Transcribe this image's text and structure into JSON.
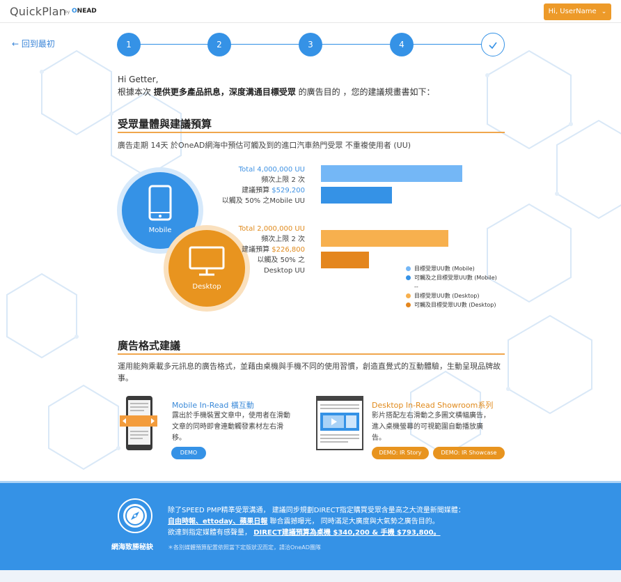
{
  "app": {
    "brand": "QuickPlan",
    "brand_by": "by",
    "brand_company_o": "O",
    "brand_company_rest": "NEAD",
    "user_button": "Hi, UserName"
  },
  "nav": {
    "back_label": "回到最初",
    "steps": [
      "1",
      "2",
      "3",
      "4"
    ]
  },
  "greeting": {
    "hello": "Hi Getter,",
    "line_prefix": "根據本次 ",
    "line_bold": "提供更多產品訊息，深度溝通目標受眾",
    "line_suffix": " 的廣告目的 ，您的建議規畫書如下："
  },
  "audience": {
    "title": "受眾量體與建議預算",
    "description": "廣告走期 14天 於OneAD網海中預估可觸及到的進口汽車熱門受眾 不重複使用者 (UU)",
    "mobile": {
      "label": "Mobile",
      "total": "Total 4,000,000 UU",
      "freq": "頻次上限 2 次",
      "budget_prefix": "建議預算 ",
      "budget": "$529,200",
      "reach": "以觸及 50% 之Mobile UU"
    },
    "desktop": {
      "label": "Desktop",
      "total": "Total 2,000,000 UU",
      "freq": "頻次上限 2 次",
      "budget_prefix": "建議預算 ",
      "budget": "$226,800",
      "reach_line1": "以觸及 50% 之",
      "reach_line2": "Desktop UU"
    },
    "bars": {
      "mobile_target": 1.0,
      "mobile_reach": 0.5,
      "desktop_target": 0.9,
      "desktop_reach": 0.34
    },
    "legend": [
      {
        "label": "目標受眾UU數 (Mobile)",
        "color": "#74b7f6"
      },
      {
        "label": "可觸及之目標受眾UU數 (Mobile)",
        "color": "#3592e6"
      },
      {
        "label": "--",
        "color": ""
      },
      {
        "label": "目標受眾UU數 (Desktop)",
        "color": "#f7b04e"
      },
      {
        "label": "可觸及目標受眾UU數 (Desktop)",
        "color": "#e4861e"
      }
    ]
  },
  "formats": {
    "title": "廣告格式建議",
    "description_line1": "運用能夠乘載多元訊息的廣告格式，並藉由桌機與手機不同的使用習慣，創造直覺式的互動體驗，生動呈現品牌故",
    "description_line2": "事。",
    "mobile": {
      "title": "Mobile In-Read 橫互動",
      "desc_lines": [
        "露出於手機裝置文章中，使用者在滑動",
        "文章的同時即會連動觸發素材左右滑",
        "移。"
      ],
      "demo": "DEMO"
    },
    "desktop": {
      "title": "Desktop In-Read Showroom系列",
      "desc_lines": [
        "影片搭配左右滑動之多圖文橫幅廣告，",
        "進入桌機螢幕的可視範圍自動播放廣",
        "告。"
      ],
      "demo1": "DEMO: IR Story",
      "demo2": "DEMO: IR Showcase"
    }
  },
  "footer": {
    "badge_label": "網海致勝秘訣",
    "line1": "除了SPEED PMP精準受眾溝通， 建議同步規劃DIRECT指定購買受眾含量高之大流量新聞媒體：",
    "line2_links": "自由時報、ettoday、蘋果日報",
    "line2_rest": " 聯合震撼曝光， 同時滿足大廣度與大氣勢之廣告目的。",
    "line3_prefix": "欲達到指定媒體有感聲量， ",
    "line3_link": "DIRECT建議預算為桌機 $340,200 & 手機 $793,800。",
    "note": "＊各別媒體預算配置依照當下定版狀況而定，請洽OneAD團隊"
  },
  "colors": {
    "accent_blue": "#3592e6",
    "accent_orange": "#ed9a29",
    "light_blue": "#74b7f6",
    "light_orange": "#f7b04e"
  }
}
